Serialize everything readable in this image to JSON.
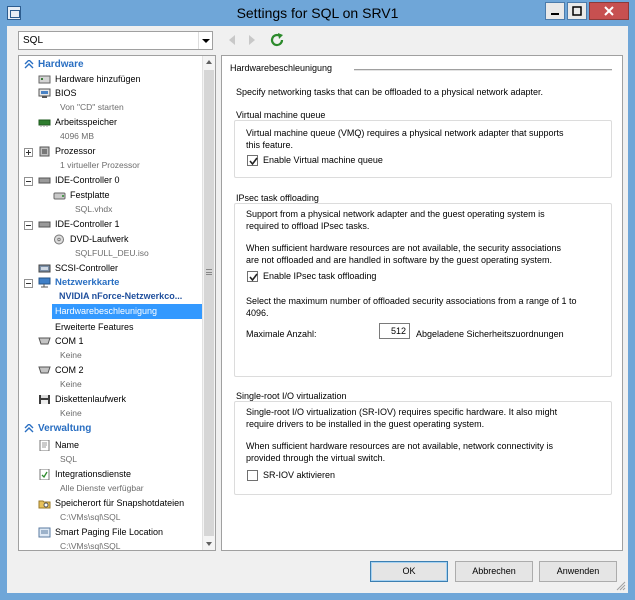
{
  "window": {
    "title": "Settings for SQL on SRV1"
  },
  "vm_selector": {
    "value": "SQL"
  },
  "tree": {
    "hardware_header": "Hardware",
    "items": [
      {
        "label": "Hardware hinzufügen"
      },
      {
        "label": "BIOS",
        "sub": "Von \"CD\" starten"
      },
      {
        "label": "Arbeitsspeicher",
        "sub": "4096 MB"
      },
      {
        "label": "Prozessor",
        "sub": "1 virtueller Prozessor"
      },
      {
        "label": "IDE-Controller 0"
      },
      {
        "label": "Festplatte",
        "sub": "SQL.vhdx"
      },
      {
        "label": "IDE-Controller 1"
      },
      {
        "label": "DVD-Laufwerk",
        "sub": "SQLFULL_DEU.iso"
      },
      {
        "label": "SCSI-Controller"
      },
      {
        "label": "Netzwerkkarte"
      },
      {
        "label": "NVIDIA nForce-Netzwerkco..."
      },
      {
        "label": "Hardwarebeschleunigung"
      },
      {
        "label": "Erweiterte Features"
      },
      {
        "label": "COM 1",
        "sub": "Keine"
      },
      {
        "label": "COM 2",
        "sub": "Keine"
      },
      {
        "label": "Diskettenlaufwerk",
        "sub": "Keine"
      }
    ],
    "management_header": "Verwaltung",
    "mgmt_items": [
      {
        "label": "Name",
        "sub": "SQL"
      },
      {
        "label": "Integrationsdienste",
        "sub": "Alle Dienste verfügbar"
      },
      {
        "label": "Speicherort für Snapshotdateien",
        "sub": "C:\\VMs\\sql\\SQL"
      },
      {
        "label": "Smart Paging File Location",
        "sub": "C:\\VMs\\sql\\SQL"
      }
    ]
  },
  "panel": {
    "heading": "Hardwarebeschleunigung",
    "intro": "Specify networking tasks that can be offloaded to a physical network adapter.",
    "vmq": {
      "title": "Virtual machine queue",
      "desc1": "Virtual machine queue (VMQ) requires a physical network adapter that supports",
      "desc2": "this feature.",
      "checkbox_label": "Enable Virtual machine queue",
      "checked": true
    },
    "ipsec": {
      "title": "IPsec task offloading",
      "desc1": "Support from a physical network adapter and the guest operating system is",
      "desc2": "required to offload IPsec tasks.",
      "desc3": "When sufficient hardware resources are not available, the security associations",
      "desc4": "are not offloaded and are handled in software by the guest operating system.",
      "checkbox_label": "Enable IPsec task offloading",
      "checked": true,
      "range1": "Select the maximum number of offloaded security associations from a range of 1 to",
      "range2": "4096.",
      "max_label": "Maximale Anzahl:",
      "max_value": "512",
      "unit_label": "Abgeladene Sicherheitszuordnungen"
    },
    "sriov": {
      "title": "Single-root I/O virtualization",
      "desc1": "Single-root I/O virtualization (SR-IOV) requires specific hardware. It also might",
      "desc2": "require drivers to be installed in the guest operating system.",
      "desc3": "When sufficient hardware resources are not available, network connectivity is",
      "desc4": "provided through the virtual switch.",
      "checkbox_label": "SR-IOV aktivieren",
      "checked": false
    }
  },
  "buttons": {
    "ok": "OK",
    "cancel": "Abbrechen",
    "apply": "Anwenden"
  },
  "colors": {
    "titlebar": "#6fa6d8",
    "selection": "#3399ff",
    "section": "#2a6fc2",
    "close": "#c75050"
  }
}
